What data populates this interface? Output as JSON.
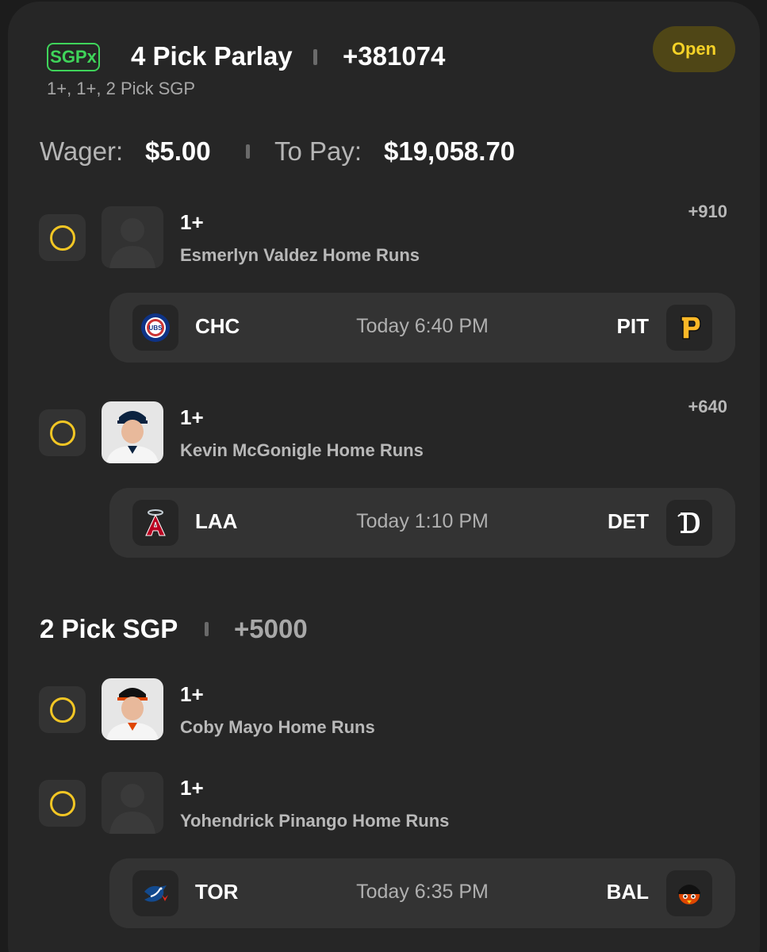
{
  "header": {
    "badge": "SGPx",
    "title": "4 Pick Parlay",
    "odds": "+381074",
    "subtitle": "1+, 1+, 2 Pick SGP",
    "status": "Open"
  },
  "wager": {
    "wager_label": "Wager:",
    "wager_value": "$5.00",
    "pay_label": "To Pay:",
    "pay_value": "$19,058.70"
  },
  "legs": [
    {
      "line": "1+",
      "market": "Esmerlyn Valdez Home Runs",
      "odds": "+910",
      "avatar": "silhouette-icon"
    },
    {
      "line": "1+",
      "market": "Kevin McGonigle Home Runs",
      "odds": "+640",
      "avatar": "player-photo"
    },
    {
      "line": "1+",
      "market": "Coby Mayo Home Runs",
      "odds": "",
      "avatar": "player-photo"
    },
    {
      "line": "1+",
      "market": "Yohendrick Pinango Home Runs",
      "odds": "",
      "avatar": "silhouette-icon"
    }
  ],
  "games": [
    {
      "away": "CHC",
      "time": "Today 6:40 PM",
      "home": "PIT",
      "away_icon": "cubs-logo-icon",
      "home_icon": "pirates-logo-icon"
    },
    {
      "away": "LAA",
      "time": "Today 1:10 PM",
      "home": "DET",
      "away_icon": "angels-logo-icon",
      "home_icon": "tigers-logo-icon"
    },
    {
      "away": "TOR",
      "time": "Today 6:35 PM",
      "home": "BAL",
      "away_icon": "bluejays-logo-icon",
      "home_icon": "orioles-logo-icon"
    }
  ],
  "sgp": {
    "title": "2 Pick SGP",
    "odds": "+5000"
  },
  "colors": {
    "background": "#262626",
    "accent_green": "#3fd45a",
    "accent_yellow": "#f2c624",
    "status_bg": "#4f4616"
  }
}
